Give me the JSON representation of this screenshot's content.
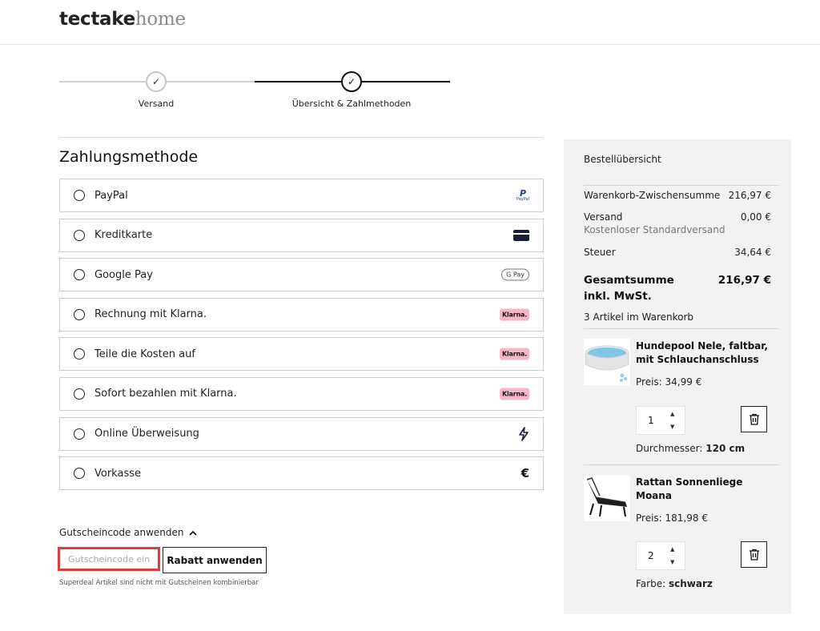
{
  "header": {
    "logo_bold": "tectake",
    "logo_light": "home"
  },
  "steps": [
    {
      "label": "Versand",
      "status": "completed"
    },
    {
      "label": "Übersicht & Zahlmethoden",
      "status": "active"
    }
  ],
  "payment": {
    "title": "Zahlungsmethode",
    "methods": [
      {
        "label": "PayPal",
        "icon": "paypal-icon",
        "icon_text": "PayPal"
      },
      {
        "label": "Kreditkarte",
        "icon": "credit-card-icon"
      },
      {
        "label": "Google Pay",
        "icon": "google-pay-icon",
        "icon_text": "G Pay"
      },
      {
        "label": "Rechnung mit Klarna.",
        "icon": "klarna-icon",
        "icon_text": "Klarna."
      },
      {
        "label": "Teile die Kosten auf",
        "icon": "klarna-icon",
        "icon_text": "Klarna."
      },
      {
        "label": "Sofort bezahlen mit Klarna.",
        "icon": "klarna-icon",
        "icon_text": "Klarna."
      },
      {
        "label": "Online Überweisung",
        "icon": "lightning-icon"
      },
      {
        "label": "Vorkasse",
        "icon": "euro-icon"
      }
    ]
  },
  "coupon": {
    "toggle_label": "Gutscheincode anwenden",
    "placeholder": "Gutscheincode eingeben",
    "button_label": "Rabatt anwenden",
    "note": "Superdeal Artikel sind nicht mit Gutscheinen kombinierbar"
  },
  "summary": {
    "title": "Bestellübersicht",
    "subtotal_label": "Warenkorb-Zwischensumme",
    "subtotal_value": "216,97 €",
    "shipping_label": "Versand",
    "shipping_value": "0,00 €",
    "shipping_note": "Kostenloser Standardversand",
    "tax_label": "Steuer",
    "tax_value": "34,64 €",
    "total_label": "Gesamtsumme inkl. MwSt.",
    "total_value": "216,97 €",
    "item_count": "3 Artikel im Warenkorb",
    "items": [
      {
        "name": "Hundepool Nele, faltbar, mit Schlauchanschluss",
        "price": "Preis: 34,99 €",
        "qty": "1",
        "attr_label": "Durchmesser:",
        "attr_value": "120 cm"
      },
      {
        "name": "Rattan Sonnenliege Moana",
        "price": "Preis: 181,98 €",
        "qty": "2",
        "attr_label": "Farbe:",
        "attr_value": "schwarz"
      }
    ]
  },
  "colors": {
    "accent": "#111111",
    "highlight": "#e23b3b",
    "summary_bg": "#f2f2f2",
    "klarna_pink": "#f7b6c8"
  }
}
